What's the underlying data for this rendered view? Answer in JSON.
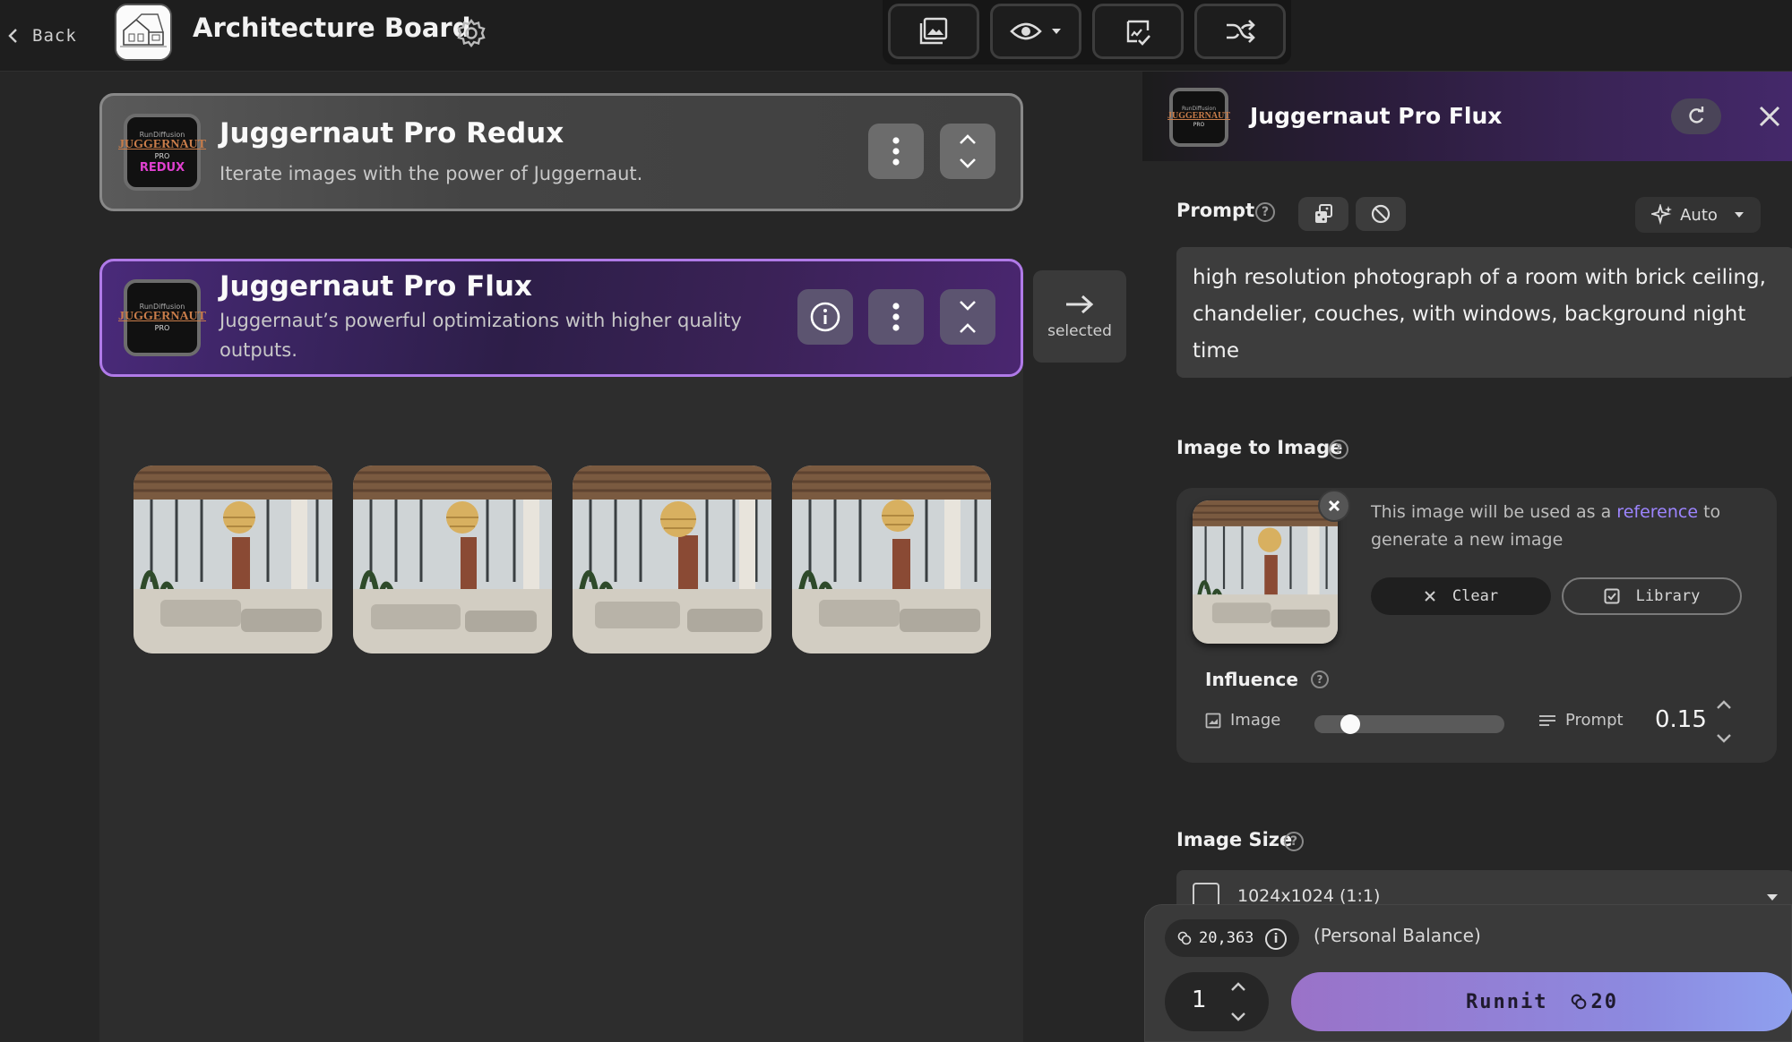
{
  "header": {
    "back_label": "Back",
    "board_title": "Architecture Board",
    "toolbar": [
      {
        "icon": "gallery-icon"
      },
      {
        "icon": "eye-icon"
      },
      {
        "icon": "checklist-icon"
      },
      {
        "icon": "shuffle-icon"
      }
    ]
  },
  "tools": [
    {
      "title": "Juggernaut Pro Redux",
      "description": "Iterate images with the power of Juggernaut.",
      "icon_text": {
        "top": "RunDiffusion",
        "main": "JUGGERNAUT",
        "sub": "PRO",
        "badge": "REDUX"
      }
    },
    {
      "title": "Juggernaut Pro Flux",
      "description": "Juggernaut’s powerful optimizations with higher quality outputs.",
      "icon_text": {
        "top": "RunDiffusion",
        "main": "JUGGERNAUT",
        "sub": "PRO"
      }
    }
  ],
  "selected_label": "selected",
  "generated_images": [
    {
      "alt": "room with brick ceiling and chandelier 1"
    },
    {
      "alt": "room with brick ceiling and chandelier 2"
    },
    {
      "alt": "room with brick ceiling and chandelier 3"
    },
    {
      "alt": "room with brick ceiling and chandelier 4"
    }
  ],
  "panel": {
    "title": "Juggernaut Pro Flux",
    "prompt_label": "Prompt",
    "auto_label": "Auto",
    "prompt_text": "high resolution photograph of a room with brick ceiling, chandelier, couches, with windows, background night time",
    "i2i_label": "Image to Image",
    "i2i_text_before": "This image will be used as a ",
    "i2i_link": "reference",
    "i2i_text_after": " to generate a new image",
    "clear_label": "Clear",
    "library_label": "Library",
    "influence_label": "Influence",
    "influence_image_label": "Image",
    "influence_prompt_label": "Prompt",
    "influence_value": "0.15",
    "influence_fraction": 0.15,
    "size_label": "Image Size",
    "size_value": "1024x1024 (1:1)"
  },
  "footer": {
    "balance": "20,363",
    "balance_label": "(Personal Balance)",
    "quantity": "1",
    "runnit_label": "Runnit",
    "cost": "20"
  },
  "colors": {
    "accent_purple": "#b07ae8",
    "link": "#9d85ff",
    "runnit_gradient_start": "#9a72c8",
    "runnit_gradient_end": "#8fa0ef"
  }
}
